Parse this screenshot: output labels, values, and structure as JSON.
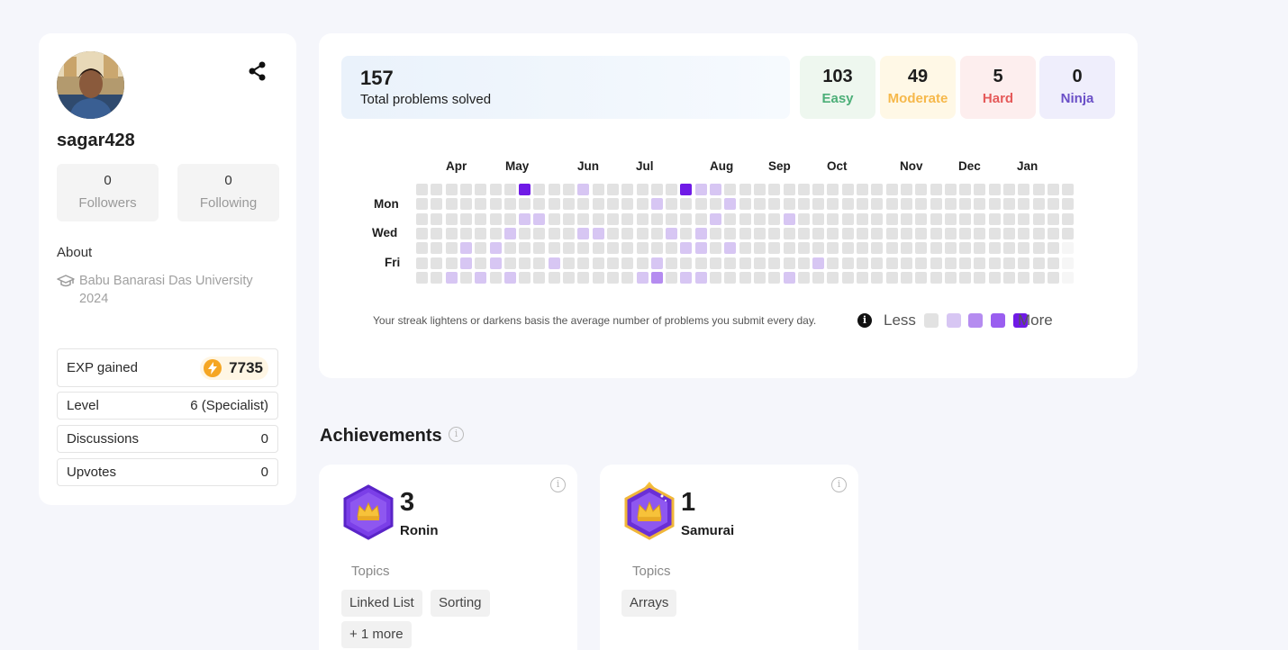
{
  "profile": {
    "username": "sagar428",
    "followers": {
      "count": "0",
      "label": "Followers"
    },
    "following": {
      "count": "0",
      "label": "Following"
    },
    "about_title": "About",
    "education": {
      "line1": "Babu Banarasi Das University",
      "line2": "2024"
    },
    "rows": [
      {
        "label": "EXP gained",
        "value": "7735"
      },
      {
        "label": "Level",
        "value": "6 (Specialist)"
      },
      {
        "label": "Discussions",
        "value": "0"
      },
      {
        "label": "Upvotes",
        "value": "0"
      }
    ]
  },
  "stats": {
    "total": {
      "count": "157",
      "label": "Total problems solved"
    },
    "difficulties": [
      {
        "count": "103",
        "label": "Easy",
        "color": "#4caf78",
        "bg": "#eef7ef"
      },
      {
        "count": "49",
        "label": "Moderate",
        "color": "#f6b84a",
        "bg": "#fff8e6"
      },
      {
        "count": "5",
        "label": "Hard",
        "color": "#e55a5a",
        "bg": "#fdeeee"
      },
      {
        "count": "0",
        "label": "Ninja",
        "color": "#6a4fc7",
        "bg": "#efeefc"
      }
    ]
  },
  "heatmap": {
    "months": [
      "Apr",
      "May",
      "Jun",
      "Jul",
      "Aug",
      "Sep",
      "Oct",
      "Nov",
      "Dec",
      "Jan"
    ],
    "days": [
      "Mon",
      "Wed",
      "Fri"
    ],
    "levels": [
      0,
      1,
      2,
      3,
      4
    ],
    "colors": [
      "#e2e2e2",
      "#d7c6f3",
      "#b58cf0",
      "#9a5ef0",
      "#6f1ae6"
    ],
    "note": "Your streak lightens or darkens basis the average number of problems you submit every day.",
    "less_label": "Less",
    "more_label": "More"
  },
  "achievements": {
    "title": "Achievements",
    "cards": [
      {
        "count": "3",
        "rank": "Ronin",
        "topics_label": "Topics",
        "topics": [
          "Linked List",
          "Sorting",
          "+ 1 more"
        ]
      },
      {
        "count": "1",
        "rank": "Samurai",
        "topics_label": "Topics",
        "topics": [
          "Arrays"
        ]
      }
    ]
  }
}
